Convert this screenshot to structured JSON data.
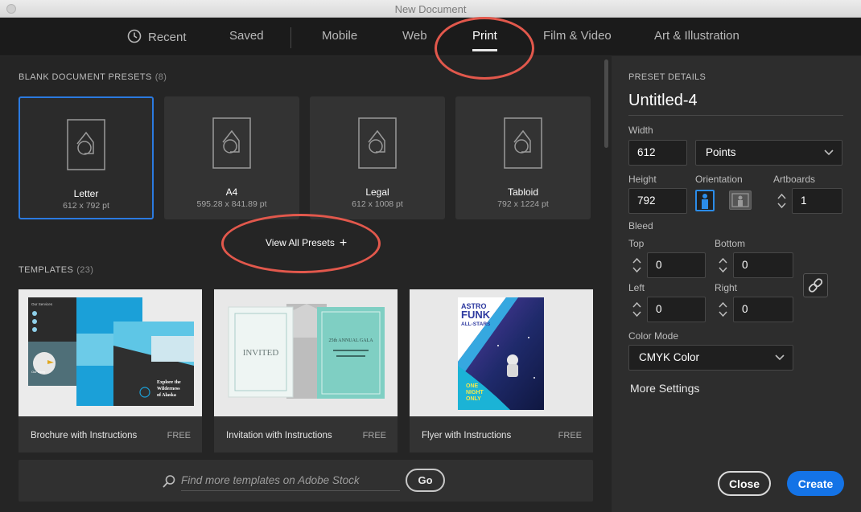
{
  "window": {
    "title": "New Document"
  },
  "tabs": [
    {
      "label": "Recent",
      "icon": "clock-icon"
    },
    {
      "label": "Saved"
    },
    {
      "label": "Mobile"
    },
    {
      "label": "Web"
    },
    {
      "label": "Print",
      "active": true
    },
    {
      "label": "Film & Video"
    },
    {
      "label": "Art & Illustration"
    }
  ],
  "blank_presets": {
    "label": "BLANK DOCUMENT PRESETS",
    "count": "(8)",
    "items": [
      {
        "name": "Letter",
        "size": "612 x 792 pt",
        "selected": true
      },
      {
        "name": "A4",
        "size": "595.28 x 841.89 pt"
      },
      {
        "name": "Legal",
        "size": "612 x 1008 pt"
      },
      {
        "name": "Tabloid",
        "size": "792 x 1224 pt"
      }
    ],
    "view_all": "View All Presets",
    "view_all_icon": "plus-icon"
  },
  "templates": {
    "label": "TEMPLATES",
    "count": "(23)",
    "items": [
      {
        "name": "Brochure with Instructions",
        "price": "FREE"
      },
      {
        "name": "Invitation with Instructions",
        "price": "FREE"
      },
      {
        "name": "Flyer with Instructions",
        "price": "FREE"
      }
    ]
  },
  "thumb_text": {
    "brochure_services": "Our Services",
    "brochure_story": "Our Story",
    "brochure_explore": "Explore the",
    "brochure_wilderness": "Wilderness",
    "brochure_alaska": "of Alaska",
    "invitation_invited": "INVITED",
    "invitation_gala": "25th ANNUAL GALA",
    "flyer_astro": "ASTRO",
    "flyer_funk": "FUNK",
    "flyer_allstars": "ALL-STARS",
    "flyer_one": "ONE",
    "flyer_night": "NIGHT",
    "flyer_only": "ONLY"
  },
  "stock_search": {
    "placeholder": "Find more templates on Adobe Stock",
    "go_label": "Go"
  },
  "preset_details": {
    "heading": "PRESET DETAILS",
    "doc_name": "Untitled-4",
    "width_label": "Width",
    "width_value": "612",
    "units": "Points",
    "height_label": "Height",
    "height_value": "792",
    "orientation_label": "Orientation",
    "orientation_selected": "portrait",
    "artboards_label": "Artboards",
    "artboards_value": "1",
    "bleed_label": "Bleed",
    "bleed": {
      "top_label": "Top",
      "top": "0",
      "bottom_label": "Bottom",
      "bottom": "0",
      "left_label": "Left",
      "left": "0",
      "right_label": "Right",
      "right": "0"
    },
    "color_mode_label": "Color Mode",
    "color_mode": "CMYK Color",
    "more_settings": "More Settings",
    "close_label": "Close",
    "create_label": "Create"
  },
  "colors": {
    "accent": "#1473e6",
    "selection_border": "#2b7ae0",
    "annotation": "#e2584c"
  }
}
